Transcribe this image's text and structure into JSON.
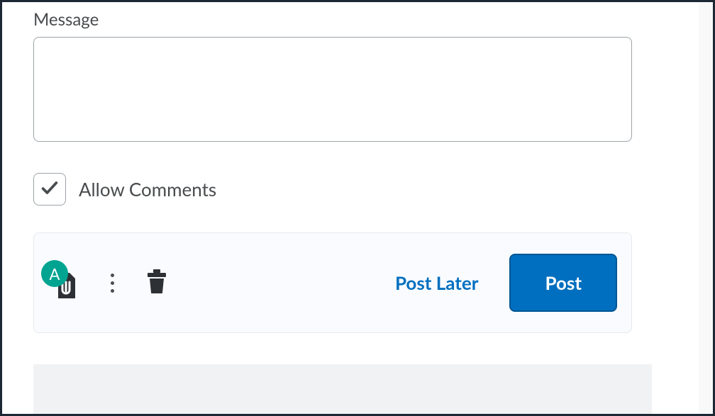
{
  "message": {
    "label": "Message",
    "value": ""
  },
  "allowComments": {
    "label": "Allow Comments",
    "checked": true
  },
  "attachBadge": "A",
  "actions": {
    "postLater": "Post Later",
    "post": "Post"
  }
}
